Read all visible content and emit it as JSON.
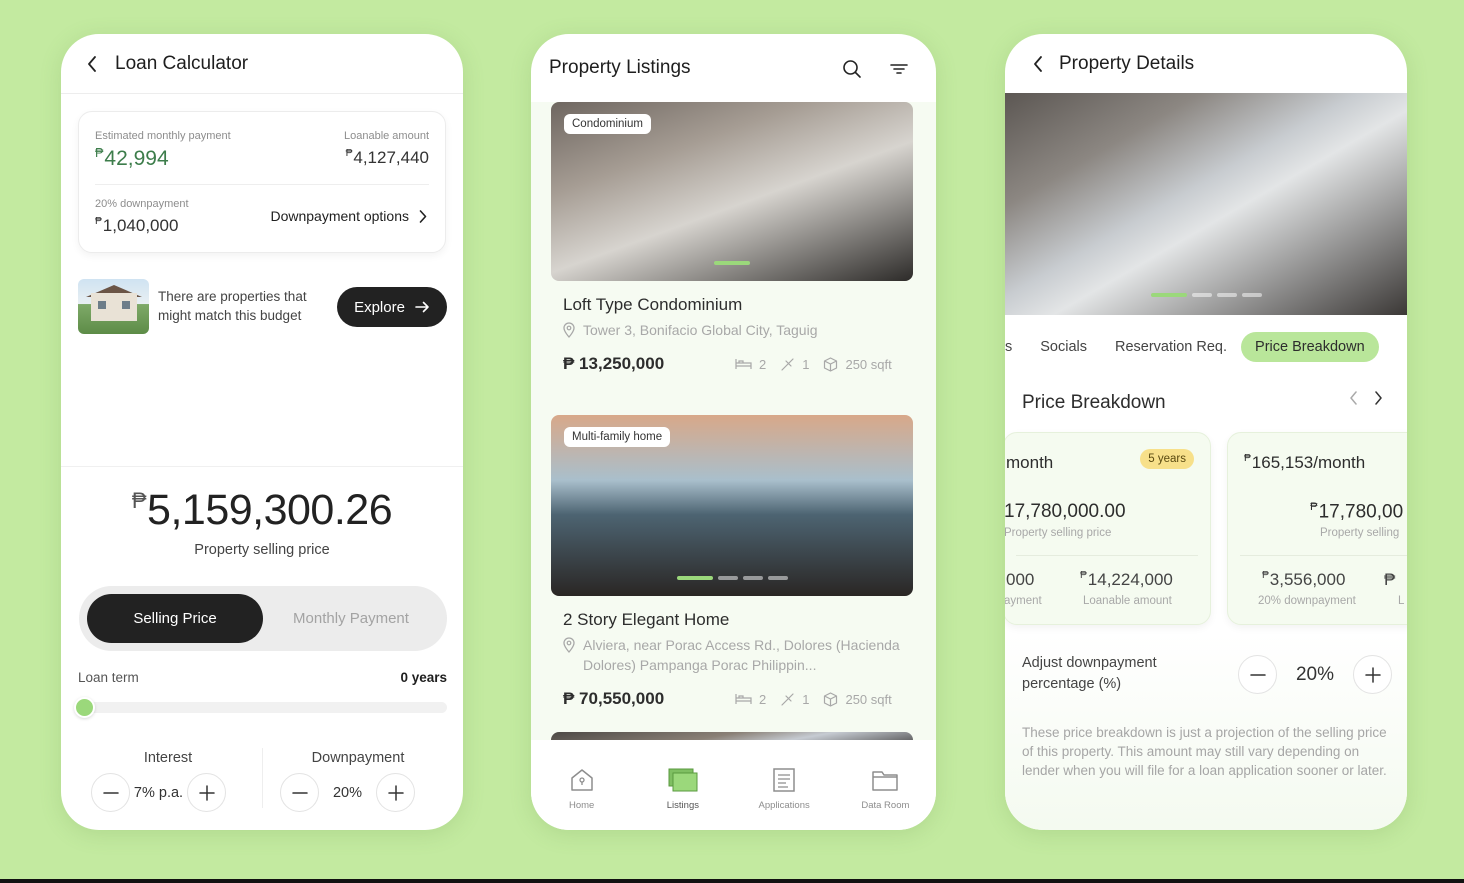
{
  "loan": {
    "title": "Loan Calculator",
    "est_monthly_label": "Estimated monthly payment",
    "est_monthly_value": "42,994",
    "loanable_label": "Loanable amount",
    "loanable_value": "4,127,440",
    "downpayment_label": "20% downpayment",
    "downpayment_value": "1,040,000",
    "downpayment_options": "Downpayment options",
    "budget_text": "There are properties that might match this budget",
    "explore_label": "Explore",
    "price_value": "5,159,300.26",
    "price_label": "Property selling price",
    "seg_selling": "Selling Price",
    "seg_monthly": "Monthly Payment",
    "term_label": "Loan term",
    "term_value": "0 years",
    "term_fraction": 0,
    "interest_label": "Interest",
    "interest_value": "7% p.a.",
    "dp_label": "Downpayment",
    "dp_value": "20%",
    "peso_sign": "₱"
  },
  "listings": {
    "title": "Property Listings",
    "items": [
      {
        "tag": "Condominium",
        "name": "Loft Type Condominium",
        "address": "Tower 3, Bonifacio Global City, Taguig",
        "price": "₱ 13,250,000",
        "beds": "2",
        "baths": "1",
        "area": "250 sqft"
      },
      {
        "tag": "Multi-family home",
        "name": "2 Story Elegant Home",
        "address": "Alviera, near Porac Access Rd., Dolores (Hacienda Dolores) Pampanga Porac Philippin...",
        "price": "₱ 70,550,000",
        "beds": "2",
        "baths": "1",
        "area": "250 sqft"
      }
    ],
    "nav": [
      "Home",
      "Listings",
      "Applications",
      "Data Room"
    ]
  },
  "details": {
    "title": "Property Details",
    "tabs": [
      "s",
      "Socials",
      "Reservation Req.",
      "Price Breakdown"
    ],
    "active_tab": "Price Breakdown",
    "section_title": "Price Breakdown",
    "card1": {
      "head": "month",
      "years": "5 years",
      "selling_value": "17,780,000.00",
      "selling_label": "Property selling price",
      "dp_value": "000",
      "dp_label": "ayment",
      "loan_value": "14,224,000",
      "loan_label": "Loanable amount"
    },
    "card2": {
      "head": "165,153/month",
      "selling_value": "17,780,00",
      "selling_label": "Property selling",
      "dp_value": "3,556,000",
      "dp_label": "20% downpayment",
      "cut_value": "₱",
      "cut_label": "L"
    },
    "adjust_label": "Adjust downpayment percentage (%)",
    "adjust_value": "20%",
    "disclaimer": "These price breakdown is just a projection of the selling price of this property. This amount may still vary depending on lender when you will file for a loan application sooner or later."
  },
  "colors": {
    "background": "#c3eaa0",
    "accent_green": "#9bd87b",
    "dark_button": "#222222",
    "price_green": "#3d7d4b",
    "years_pill": "#f7e08a"
  }
}
